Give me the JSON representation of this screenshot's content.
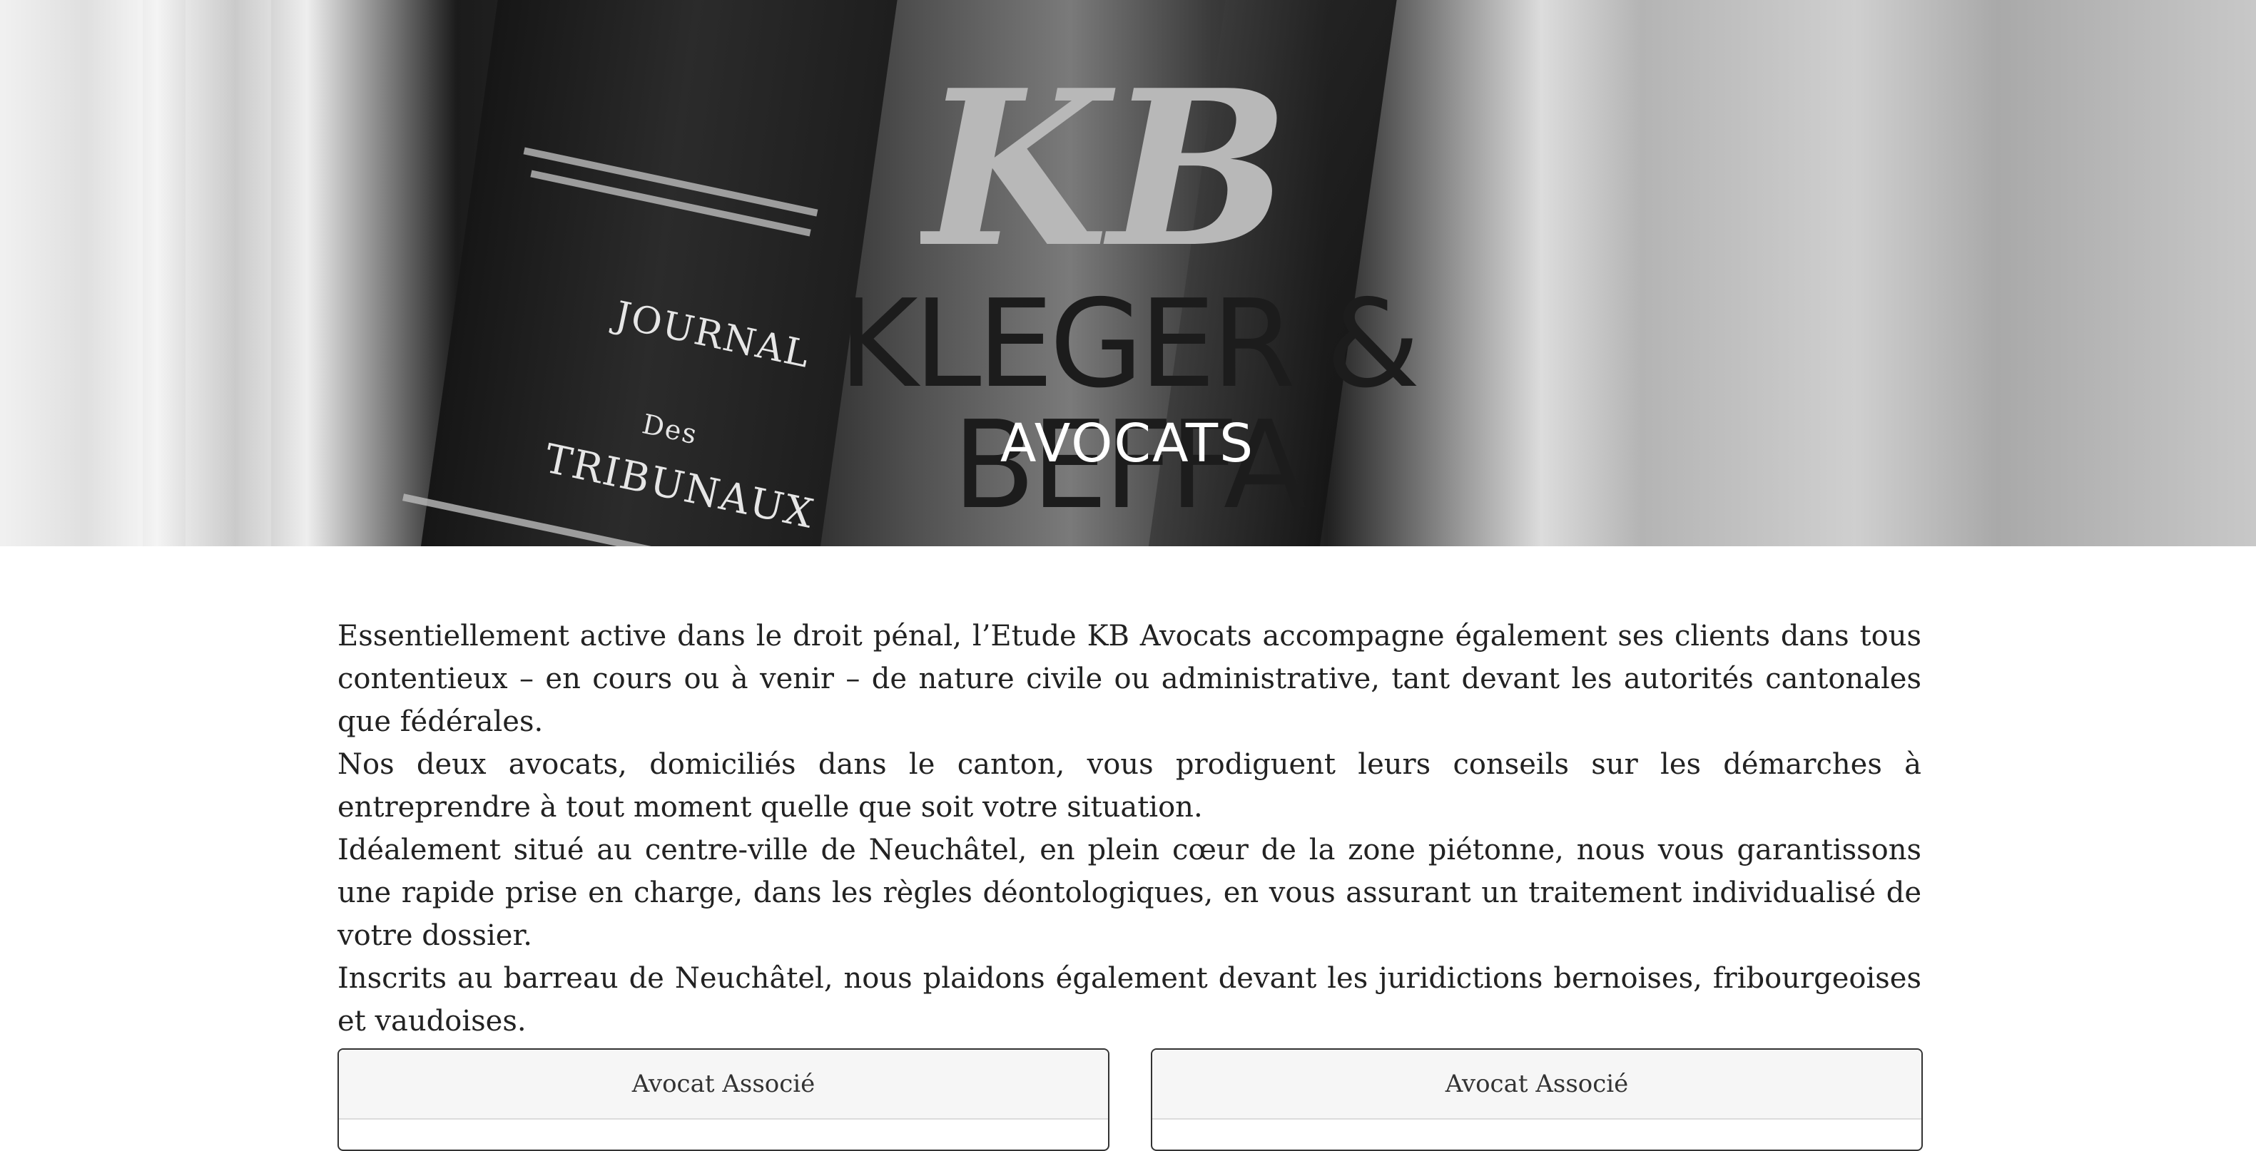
{
  "hero": {
    "spine_text": [
      "JOURNAL",
      "Des",
      "TRIBUNAUX"
    ],
    "logo": {
      "monogram": "KB",
      "name": "KLEGER & BEFFA",
      "subtitle": "AVOCATS"
    }
  },
  "intro": {
    "paragraphs": [
      "Essentiellement active dans le droit pénal, l’Etude KB Avocats accompagne également ses clients dans tous contentieux – en cours ou à venir – de nature civile ou administrative, tant devant les autorités cantonales que fédérales.",
      "Nos deux avocats, domiciliés dans le canton, vous prodiguent leurs conseils sur les démarches à entreprendre à tout moment quelle que soit votre situation.",
      "Idéalement situé au centre-ville de Neuchâtel, en plein cœur de la zone piétonne, nous vous garantissons une rapide prise en charge, dans les règles déontologiques, en vous assurant un traitement individualisé de votre dossier.",
      "Inscrits au barreau de Neuchâtel, nous plaidons également devant les juridictions bernoises, fribourgeoises et vaudoises."
    ]
  },
  "cards": [
    {
      "title": "Avocat Associé"
    },
    {
      "title": "Avocat Associé"
    }
  ]
}
